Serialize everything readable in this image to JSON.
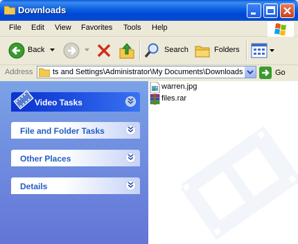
{
  "window": {
    "title": "Downloads"
  },
  "menu": [
    "File",
    "Edit",
    "View",
    "Favorites",
    "Tools",
    "Help"
  ],
  "toolbar": {
    "back_label": "Back",
    "search_label": "Search",
    "folders_label": "Folders"
  },
  "address": {
    "label": "Address",
    "value": "ts and Settings\\Administrator\\My Documents\\Downloads",
    "go_label": "Go"
  },
  "tasks": [
    {
      "title": "Video Tasks",
      "special": true
    },
    {
      "title": "File and Folder Tasks"
    },
    {
      "title": "Other Places"
    },
    {
      "title": "Details"
    }
  ],
  "files": [
    {
      "name": "warren.jpg",
      "icon": "jpg-image-icon"
    },
    {
      "name": "files.rar",
      "icon": "rar-archive-icon"
    }
  ],
  "colors": {
    "titlebar": "#0a5fe0",
    "taskpane": "#7ba2e7",
    "task_title": "#215dc6"
  }
}
